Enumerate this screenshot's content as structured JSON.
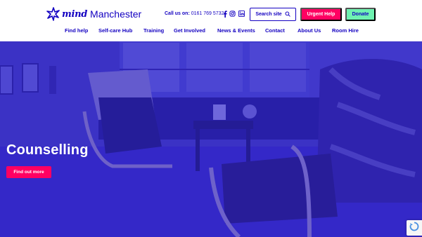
{
  "header": {
    "logo": {
      "brand": "mind",
      "city": "Manchester"
    },
    "call_label": "Call us on:",
    "phone": "0161 769 5732",
    "social": [
      "facebook-icon",
      "instagram-icon",
      "linkedin-icon"
    ],
    "search_label": "Search site",
    "urgent_label": "Urgent Help",
    "donate_label": "Donate"
  },
  "nav": {
    "items": [
      {
        "label": "Find help"
      },
      {
        "label": "Self-care Hub"
      },
      {
        "label": "Training"
      },
      {
        "label": "Get Involved"
      },
      {
        "label": "News & Events"
      },
      {
        "label": "Contact"
      },
      {
        "label": "About Us"
      },
      {
        "label": "Room Hire"
      }
    ]
  },
  "hero": {
    "title": "Counselling",
    "button_label": "Find out more"
  },
  "colors": {
    "brand_blue": "#1300c1",
    "urgent_pink": "#ff0062",
    "donate_green": "#6ff2b1",
    "hero_overlay": "#3a2ecb"
  }
}
